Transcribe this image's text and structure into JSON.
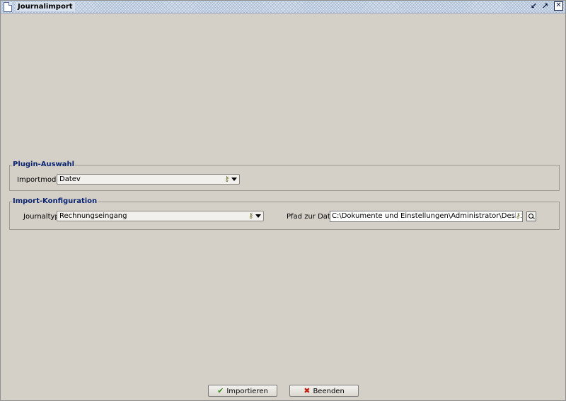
{
  "window": {
    "title": "Journalimport",
    "controls": {
      "minimize_icon": "↙",
      "maximize_icon": "↗",
      "close_icon": "✕"
    }
  },
  "plugin_section": {
    "title": "Plugin-Auswahl",
    "importmodul_label": "Importmodul:",
    "importmodul_value": "Datev"
  },
  "import_section": {
    "title": "Import-Konfiguration",
    "journaltyp_label": "Journaltyp:",
    "journaltyp_value": "Rechnungseingang",
    "pfad_label": "Pfad zur Datei:",
    "pfad_value": "C:\\Dokumente und Einstellungen\\Administrator\\Desktop\\TESTBUCH"
  },
  "buttons": {
    "import_label": "Importieren",
    "close_label": "Beenden"
  },
  "icons": {
    "key_glyph": "⚷",
    "check_glyph": "✔",
    "cross_glyph": "✖"
  }
}
